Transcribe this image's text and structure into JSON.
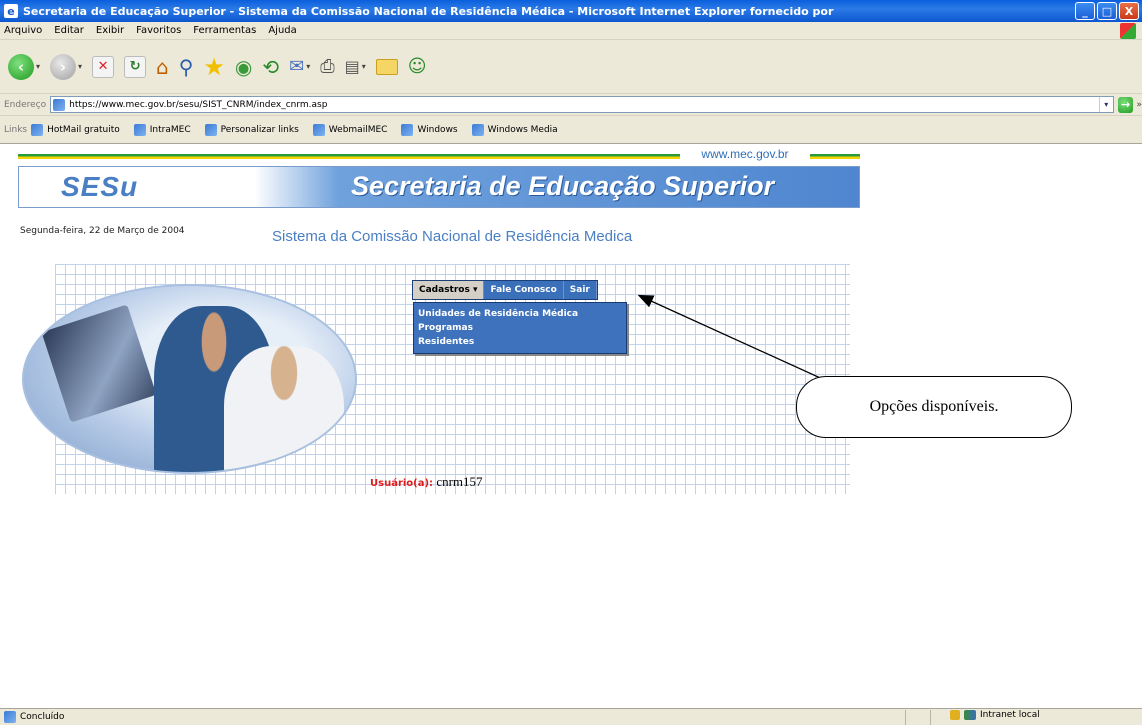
{
  "window": {
    "title": "Secretaria de Educação Superior - Sistema da Comissão Nacional de Residência Médica - Microsoft Internet Explorer fornecido por",
    "buttons": [
      "_",
      "□",
      "X"
    ]
  },
  "menubar": {
    "items": [
      "Arquivo",
      "Editar",
      "Exibir",
      "Favoritos",
      "Ferramentas",
      "Ajuda"
    ]
  },
  "toolbar": {
    "icons": [
      "back-icon",
      "forward-icon",
      "stop-icon",
      "refresh-icon",
      "home-icon",
      "search-icon",
      "favorites-icon",
      "media-icon",
      "history-icon",
      "mail-icon",
      "print-icon",
      "edit-icon",
      "folder-icon",
      "messenger-icon"
    ]
  },
  "address": {
    "label": "Endereço",
    "url": "https://www.mec.gov.br/sesu/SIST_CNRM/index_cnrm.asp"
  },
  "links": {
    "label": "Links",
    "items": [
      "HotMail gratuito",
      "IntraMEC",
      "Personalizar links",
      "WebmailMEC",
      "Windows",
      "Windows Media"
    ]
  },
  "page": {
    "site_url": "www.mec.gov.br",
    "banner_logo": "SESu",
    "banner_title": "Secretaria de Educação Superior",
    "date": "Segunda-feira, 22 de Março de 2004",
    "system_title": "Sistema da Comissão Nacional de Residência Medica",
    "nav": {
      "cadastros": "Cadastros ▾",
      "fale_conosco": "Fale Conosco",
      "sair": "Sair"
    },
    "dropdown": [
      "Unidades de Residência Médica",
      "Programas",
      "Residentes"
    ],
    "callout": "Opções disponíveis.",
    "user_label": "Usuário(a):",
    "user_value": "cnrm157"
  },
  "status": {
    "text": "Concluído",
    "zone": "Intranet local"
  },
  "colors": {
    "titlebar": "#0a5fdc",
    "chrome": "#ece9d8",
    "nav_blue": "#3a6fba",
    "title_blue": "#4a7fc4",
    "user_label_red": "#e01a1a"
  }
}
